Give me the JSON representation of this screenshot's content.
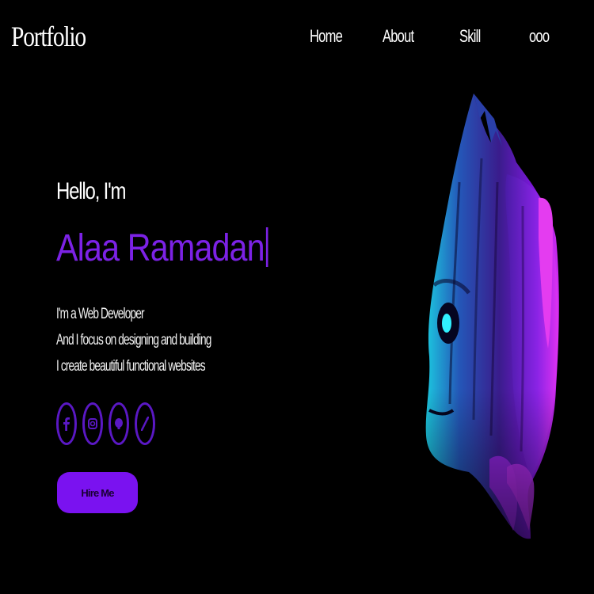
{
  "header": {
    "logo": "Portfolio"
  },
  "nav": {
    "items": [
      {
        "label": "Home"
      },
      {
        "label": "About"
      },
      {
        "label": "Skill"
      },
      {
        "label": "ooo"
      }
    ]
  },
  "hero": {
    "greeting": "Hello, I'm",
    "name": "Alaa Ramadan",
    "description": [
      "I'm a Web Developer",
      "And I focus on designing and building",
      "I create beautiful functional websites"
    ],
    "socials": [
      {
        "icon": "facebook-icon"
      },
      {
        "icon": "instagram-icon"
      },
      {
        "icon": "github-icon"
      },
      {
        "icon": "linkedin-icon"
      }
    ],
    "cta_label": "Hire Me"
  },
  "colors": {
    "background": "#000000",
    "accent": "#7c22e6",
    "button": "#7a12f0",
    "social_ring": "#5a18c4",
    "text": "#ffffff"
  }
}
